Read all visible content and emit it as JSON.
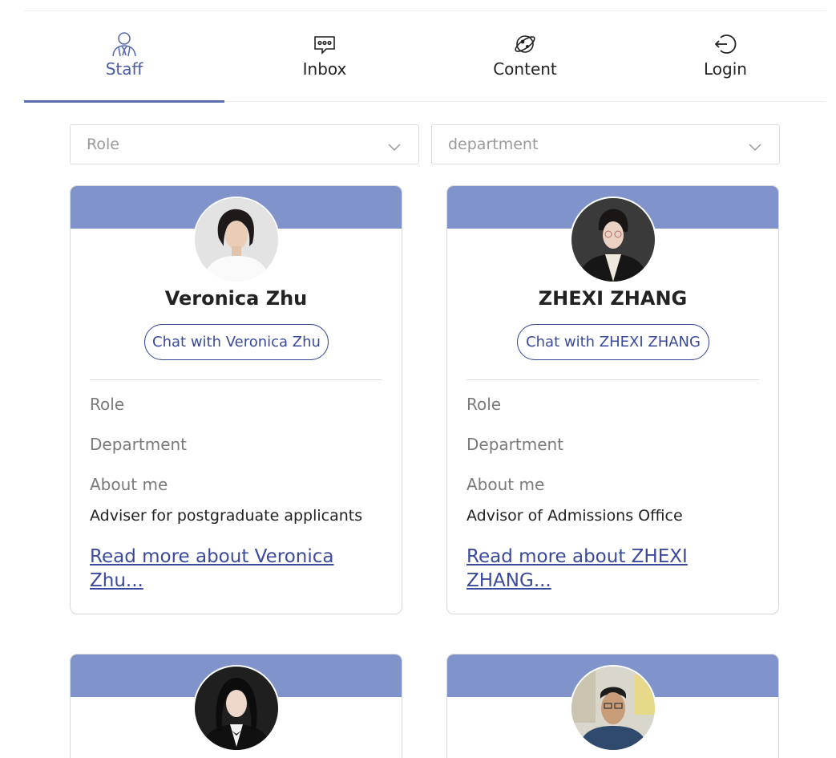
{
  "tabs": [
    {
      "label": "Staff",
      "icon": "user-tie-icon",
      "active": true
    },
    {
      "label": "Inbox",
      "icon": "chat-bubble-icon",
      "active": false
    },
    {
      "label": "Content",
      "icon": "planet-icon",
      "active": false
    },
    {
      "label": "Login",
      "icon": "login-icon",
      "active": false
    }
  ],
  "filters": {
    "role_placeholder": "Role",
    "department_placeholder": "department"
  },
  "labels": {
    "role": "Role",
    "department": "Department",
    "about": "About me"
  },
  "staff": [
    {
      "name": "Veronica Zhu",
      "chat_label": "Chat with Veronica Zhu",
      "about": "Adviser for postgraduate applicants",
      "read_more": "Read more about Veronica Zhu..."
    },
    {
      "name": "ZHEXI ZHANG",
      "chat_label": "Chat with ZHEXI ZHANG",
      "about": "Advisor of Admissions Office",
      "read_more": "Read more about ZHEXI ZHANG..."
    }
  ],
  "colors": {
    "accent": "#4a5ba5",
    "banner": "#8094cb",
    "link": "#3b4a9c"
  }
}
